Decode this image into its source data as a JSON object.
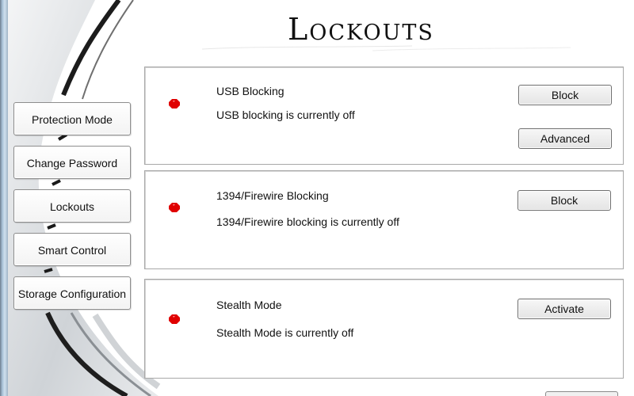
{
  "header": {
    "title": "Lockouts"
  },
  "sidebar": {
    "items": [
      {
        "label": "Protection Mode"
      },
      {
        "label": "Change Password"
      },
      {
        "label": "Lockouts"
      },
      {
        "label": "Smart Control"
      },
      {
        "label": "Storage Configuration"
      }
    ]
  },
  "panels": [
    {
      "title": "USB Blocking",
      "status": "USB blocking is currently off",
      "primary_button": "Block",
      "secondary_button": "Advanced",
      "indicator": "red-status-light"
    },
    {
      "title": "1394/Firewire Blocking",
      "status": "1394/Firewire blocking is currently off",
      "primary_button": "Block",
      "indicator": "red-status-light"
    },
    {
      "title": "Stealth Mode",
      "status": "Stealth Mode is currently off",
      "primary_button": "Activate",
      "indicator": "red-status-light"
    }
  ],
  "colors": {
    "status_off": "#e00000",
    "accent_dark": "#2b2b2b",
    "frame_blue": "#a9c2d8"
  }
}
